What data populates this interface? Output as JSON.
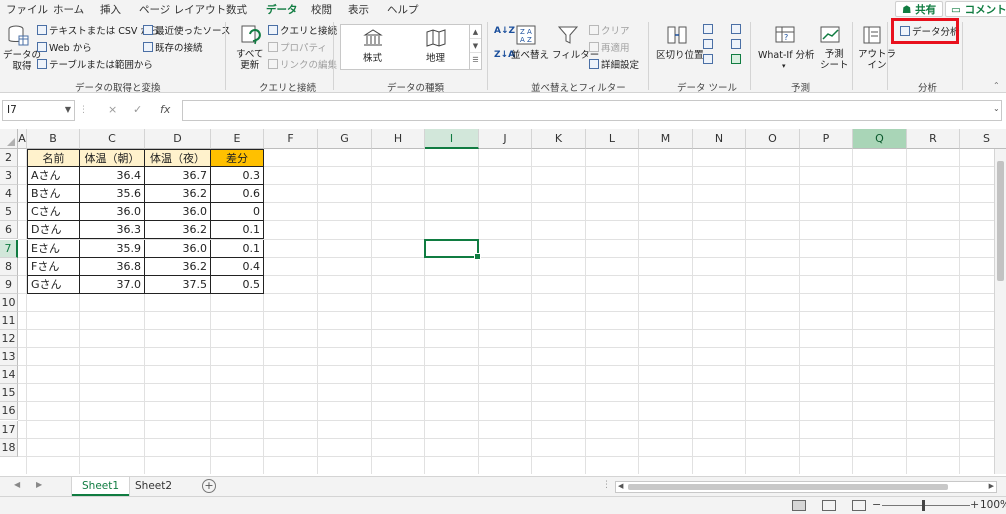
{
  "menu": {
    "tabs": [
      "ファイル",
      "ホーム",
      "挿入",
      "ページ レイアウト",
      "数式",
      "データ",
      "校閲",
      "表示",
      "ヘルプ"
    ],
    "active": "データ",
    "share": "共有",
    "comment": "コメント"
  },
  "ribbon": {
    "get_data": {
      "big_button": "データの\n取得",
      "from_text_csv": "テキストまたは CSV から",
      "from_web": "Web から",
      "from_table": "テーブルまたは範囲から",
      "recent_sources": "最近使ったソース",
      "existing_connections": "既存の接続",
      "label": "データの取得と変換"
    },
    "queries": {
      "refresh_all": "すべて\n更新",
      "queries_connections": "クエリと接続",
      "properties": "プロパティ",
      "edit_links": "リンクの編集",
      "label": "クエリと接続"
    },
    "data_types": {
      "stocks": "株式",
      "geography": "地理",
      "label": "データの種類"
    },
    "sort_filter": {
      "sort": "並べ替え",
      "filter": "フィルター",
      "clear": "クリア",
      "reapply": "再適用",
      "advanced": "詳細設定",
      "label": "並べ替えとフィルター"
    },
    "data_tools": {
      "text_to_columns": "区切り位置",
      "label": "データ ツール"
    },
    "forecast": {
      "what_if": "What-If 分析",
      "forecast_sheet": "予測\nシート",
      "label": "予測"
    },
    "outline": {
      "outline": "アウトラ\nイン"
    },
    "analysis": {
      "data_analysis": "データ分析",
      "label": "分析"
    }
  },
  "formula_bar": {
    "name_box": "I7",
    "cancel": "×",
    "enter": "✓",
    "fx": "fx",
    "value": ""
  },
  "grid": {
    "columns": [
      "A",
      "B",
      "C",
      "D",
      "E",
      "F",
      "G",
      "H",
      "I",
      "J",
      "K",
      "L",
      "M",
      "N",
      "O",
      "P",
      "Q",
      "R",
      "S"
    ],
    "rows": [
      "2",
      "3",
      "4",
      "5",
      "6",
      "7",
      "8",
      "9",
      "10",
      "11",
      "12",
      "13",
      "14",
      "15",
      "16",
      "17",
      "18"
    ],
    "selected_column": "I",
    "highlighted_column": "Q",
    "selected_row": "7",
    "active_cell": "I7"
  },
  "table": {
    "headers": [
      "名前",
      "体温（朝）",
      "体温（夜）",
      "差分"
    ],
    "rows": [
      [
        "Aさん",
        "36.4",
        "36.7",
        "0.3"
      ],
      [
        "Bさん",
        "35.6",
        "36.2",
        "0.6"
      ],
      [
        "Cさん",
        "36.0",
        "36.0",
        "0"
      ],
      [
        "Dさん",
        "36.3",
        "36.2",
        "0.1"
      ],
      [
        "Eさん",
        "35.9",
        "36.0",
        "0.1"
      ],
      [
        "Fさん",
        "36.8",
        "36.2",
        "0.4"
      ],
      [
        "Gさん",
        "37.0",
        "37.5",
        "0.5"
      ]
    ]
  },
  "sheets": {
    "tabs": [
      "Sheet1",
      "Sheet2"
    ],
    "active": "Sheet1"
  },
  "status": {
    "zoom": "100%",
    "minus": "−",
    "plus": "+"
  },
  "colors": {
    "accent": "#107c41",
    "header_fill": "#fff2cc",
    "diff_header_fill": "#ffc000",
    "callout": "#e8101c"
  }
}
